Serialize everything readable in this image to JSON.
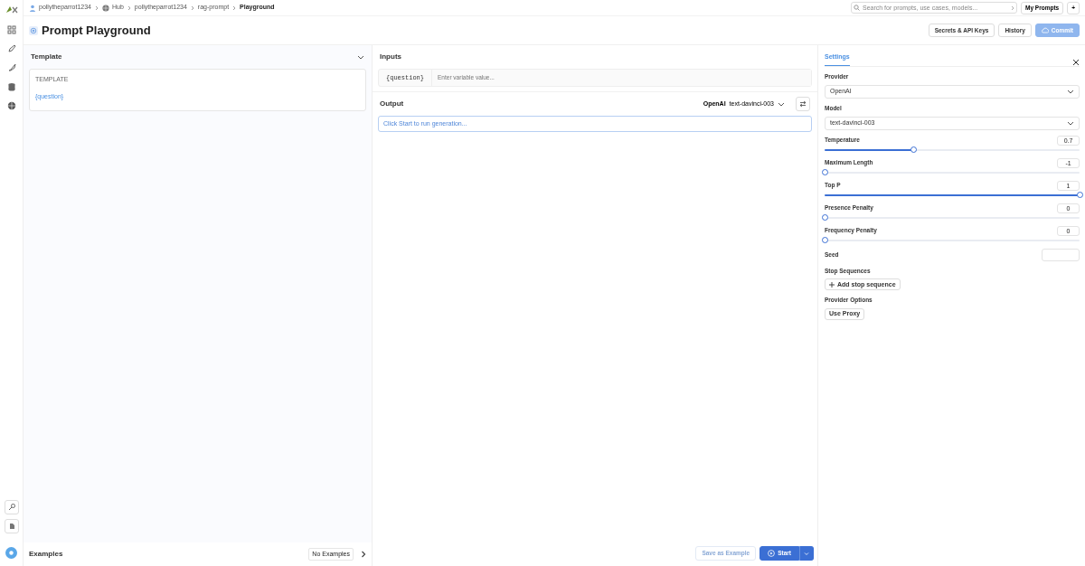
{
  "breadcrumbs": [
    {
      "label": "pollytheparrot1234",
      "kind": "user",
      "current": false
    },
    {
      "label": "Hub",
      "kind": "hub",
      "current": false
    },
    {
      "label": "pollytheparrot1234",
      "kind": "plain",
      "current": false
    },
    {
      "label": "rag-prompt",
      "kind": "plain",
      "current": false
    },
    {
      "label": "Playground",
      "kind": "plain",
      "current": true
    }
  ],
  "search": {
    "placeholder": "Search for prompts, use cases, models..."
  },
  "top_buttons": [
    "My Prompts",
    "+"
  ],
  "title": "Prompt Playground",
  "header_buttons": [
    {
      "label": "Secrets & API Keys",
      "kind": "outline",
      "disabled": false
    },
    {
      "label": "History",
      "kind": "outline",
      "disabled": false
    },
    {
      "label": "Commit",
      "kind": "primary",
      "disabled": true
    }
  ],
  "template": {
    "heading": "Template",
    "label": "TEMPLATE",
    "body": "{question}"
  },
  "examples": {
    "heading": "Examples",
    "badge": "No Examples"
  },
  "inputs": {
    "heading": "Inputs",
    "variables": [
      {
        "name": "{question}",
        "placeholder": "Enter variable value..."
      }
    ]
  },
  "output": {
    "heading": "Output",
    "provider": "OpenAI",
    "model": "text-davinci-003",
    "placeholder": "Click Start to run generation..."
  },
  "footer_buttons": [
    {
      "label": "Save as Example",
      "kind": "outline",
      "disabled": true
    },
    {
      "label": "Start",
      "kind": "primary",
      "disabled": false
    }
  ],
  "settings": {
    "tab": "Settings",
    "provider": {
      "label": "Provider",
      "value": "OpenAI"
    },
    "model": {
      "label": "Model",
      "value": "text-davinci-003"
    },
    "sliders": [
      {
        "label": "Temperature",
        "reading": "0.7",
        "level": 0.35
      },
      {
        "label": "Maximum Length",
        "reading": "-1",
        "level": 0
      },
      {
        "label": "Top P",
        "reading": "1",
        "level": 1
      },
      {
        "label": "Presence Penalty",
        "reading": "0",
        "level": 0
      },
      {
        "label": "Frequency Penalty",
        "reading": "0",
        "level": 0
      }
    ],
    "seed": {
      "label": "Seed"
    },
    "stop_sequences": {
      "label": "Stop Sequences",
      "button": "Add stop sequence"
    },
    "provider_options": {
      "label": "Provider Options",
      "button": "Use Proxy"
    }
  }
}
